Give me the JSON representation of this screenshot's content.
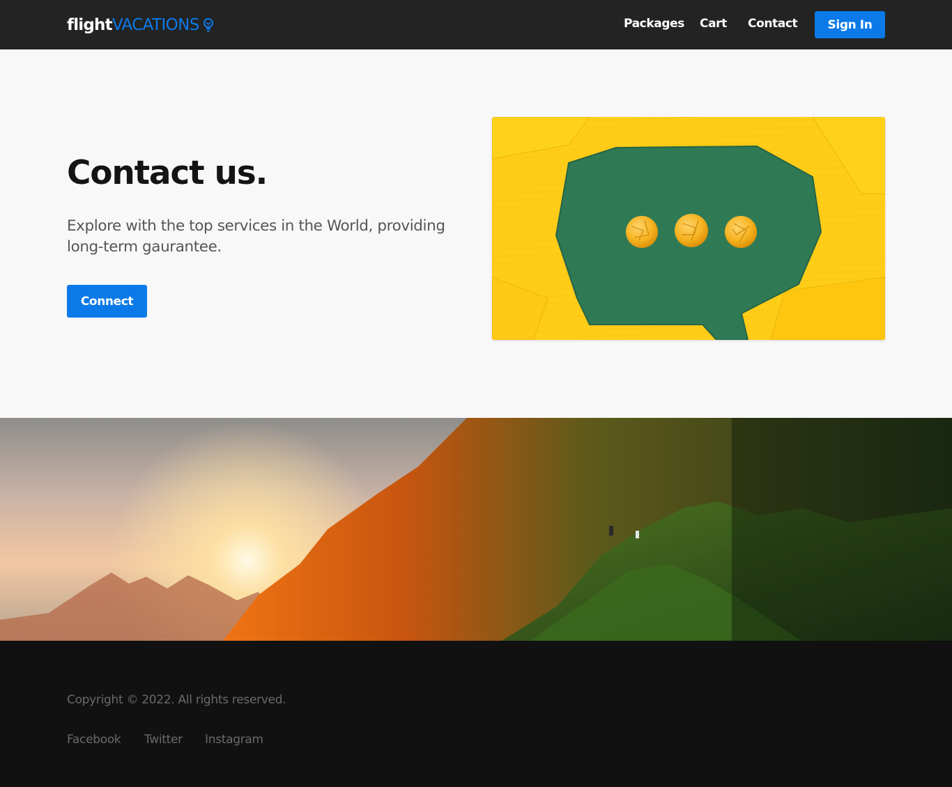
{
  "nav": {
    "brand_part1": "flight",
    "brand_part2": "VACATIONS",
    "brand_icon": "bulb-icon",
    "links": [
      "Packages",
      "Cart",
      "Contact"
    ],
    "signin_label": "Sign In"
  },
  "hero": {
    "title": "Contact us.",
    "text": "Explore with the top services in the World, providing long-term gaurantee.",
    "button_label": "Connect",
    "image": "speech-bubble-illustration"
  },
  "banner": {
    "image": "mountain-sunset-photo"
  },
  "footer": {
    "copyright": "Copyright © 2022. All rights reserved.",
    "social_links": [
      "Facebook",
      "Twitter",
      "Instagram"
    ]
  },
  "colors": {
    "accent": "#0b7ae8",
    "navbar_bg": "#232323",
    "page_bg": "#f8f8f8",
    "footer_bg": "#111111",
    "footer_text": "#6a6a6a"
  }
}
